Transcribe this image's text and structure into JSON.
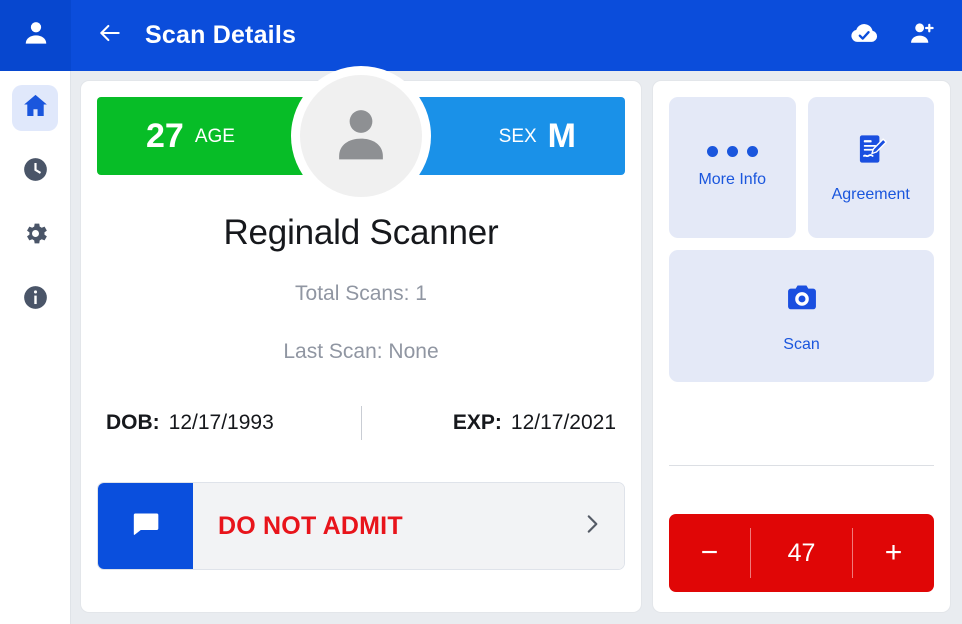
{
  "header": {
    "title": "Scan Details",
    "back_icon": "arrow-left-icon",
    "profile_icon": "person-icon",
    "cloud_done_icon": "cloud-done-icon",
    "add_person_icon": "person-add-icon",
    "bg_color": "#0b4ddb"
  },
  "sidebar": {
    "items": [
      {
        "name": "home",
        "icon": "home-icon",
        "active": true
      },
      {
        "name": "history",
        "icon": "clock-icon",
        "active": false
      },
      {
        "name": "settings",
        "icon": "gear-icon",
        "active": false
      },
      {
        "name": "info",
        "icon": "info-icon",
        "active": false
      }
    ],
    "active_color": "#1a56dd",
    "inactive_color": "#4a5568"
  },
  "profile": {
    "age_value": "27",
    "age_label": "AGE",
    "age_color": "#07bd27",
    "sex_label": "SEX",
    "sex_value": "M",
    "sex_color": "#1a91e8",
    "avatar_icon": "person-avatar-icon",
    "name": "Reginald Scanner",
    "total_scans": "Total Scans: 1",
    "last_scan": "Last Scan: None",
    "dob_label": "DOB:",
    "dob_value": "12/17/1993",
    "exp_label": "EXP:",
    "exp_value": "12/17/2021"
  },
  "admit": {
    "icon": "chat-bubble-icon",
    "text": "DO NOT ADMIT",
    "text_color": "#e8141b",
    "chevron_icon": "chevron-right-icon"
  },
  "actions": {
    "more_info": {
      "label": "More Info",
      "icon": "three-dots-icon"
    },
    "agreement": {
      "label": "Agreement",
      "icon": "document-sign-icon"
    },
    "scan": {
      "label": "Scan",
      "icon": "camera-icon"
    },
    "tile_bg": "#e4e9f7",
    "tile_fg": "#1a56dd"
  },
  "counter": {
    "value": "47",
    "decrement_label": "−",
    "increment_label": "+",
    "bg_color": "#e00606"
  }
}
